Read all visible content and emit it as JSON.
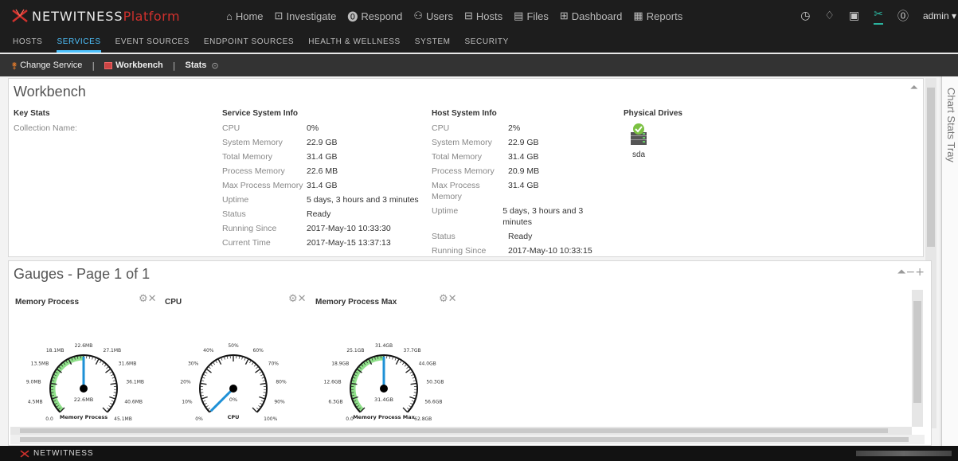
{
  "app": {
    "brand": "NETWITNESS",
    "product": "Platform",
    "user": "admin",
    "footer_brand": "NETWITNESS"
  },
  "mainnav": [
    {
      "icon": "home-icon",
      "glyph": "⌂",
      "label": "Home"
    },
    {
      "icon": "investigate-icon",
      "glyph": "⊡",
      "label": "Investigate"
    },
    {
      "icon": "respond-icon",
      "glyph": "⓿",
      "label": "Respond"
    },
    {
      "icon": "users-icon",
      "glyph": "⚇",
      "label": "Users"
    },
    {
      "icon": "hosts-icon",
      "glyph": "⊟",
      "label": "Hosts"
    },
    {
      "icon": "files-icon",
      "glyph": "▤",
      "label": "Files"
    },
    {
      "icon": "dashboard-icon",
      "glyph": "⊞",
      "label": "Dashboard"
    },
    {
      "icon": "reports-icon",
      "glyph": "▦",
      "label": "Reports"
    }
  ],
  "subnav": [
    "HOSTS",
    "SERVICES",
    "EVENT SOURCES",
    "ENDPOINT SOURCES",
    "HEALTH & WELLNESS",
    "SYSTEM",
    "SECURITY"
  ],
  "toolbar": {
    "change_service": "Change Service",
    "workbench": "Workbench",
    "stats": "Stats"
  },
  "workbench": {
    "title": "Workbench",
    "key_stats": {
      "header": "Key Stats",
      "rows": [
        {
          "k": "Collection Name:",
          "v": ""
        }
      ]
    },
    "service_system": {
      "header": "Service System Info",
      "rows": [
        {
          "k": "CPU",
          "v": "0%"
        },
        {
          "k": "System Memory",
          "v": "22.9 GB"
        },
        {
          "k": "Total Memory",
          "v": "31.4 GB"
        },
        {
          "k": "Process Memory",
          "v": "22.6 MB"
        },
        {
          "k": "Max Process Memory",
          "v": "31.4 GB"
        },
        {
          "k": "Uptime",
          "v": "5 days, 3 hours and 3 minutes"
        },
        {
          "k": "Status",
          "v": "Ready"
        },
        {
          "k": "Running Since",
          "v": "2017-May-10 10:33:30"
        },
        {
          "k": "Current Time",
          "v": "2017-May-15 13:37:13"
        }
      ]
    },
    "host_system": {
      "header": "Host System Info",
      "rows": [
        {
          "k": "CPU",
          "v": "2%"
        },
        {
          "k": "System Memory",
          "v": "22.9 GB"
        },
        {
          "k": "Total Memory",
          "v": "31.4 GB"
        },
        {
          "k": "Process Memory",
          "v": "20.9 MB"
        },
        {
          "k": "Max Process Memory",
          "v": "31.4 GB"
        },
        {
          "k": "Uptime",
          "v": "5 days, 3 hours and 3 minutes"
        },
        {
          "k": "Status",
          "v": "Ready"
        },
        {
          "k": "Running Since",
          "v": "2017-May-10 10:33:15"
        }
      ]
    },
    "physical_drives": {
      "header": "Physical Drives",
      "drive": "sda"
    }
  },
  "gauges": {
    "title": "Gauges - Page 1 of 1",
    "items": [
      {
        "name": "Memory Process",
        "center_label": "Memory Process",
        "value_label": "22.6MB",
        "ticks": [
          "0.0",
          "4.5MB",
          "9.0MB",
          "13.5MB",
          "18.1MB",
          "22.6MB",
          "27.1MB",
          "31.6MB",
          "36.1MB",
          "40.6MB",
          "45.1MB"
        ],
        "value_fraction": 0.5,
        "band_fraction": 0.5
      },
      {
        "name": "CPU",
        "center_label": "CPU",
        "value_label": "0%",
        "ticks": [
          "0%",
          "10%",
          "20%",
          "30%",
          "40%",
          "50%",
          "60%",
          "70%",
          "80%",
          "90%",
          "100%"
        ],
        "value_fraction": 0.0,
        "band_fraction": 0.0
      },
      {
        "name": "Memory Process Max",
        "center_label": "Memory Process Max",
        "value_label": "31.4GB",
        "ticks": [
          "0.0",
          "6.3GB",
          "12.6GB",
          "18.9GB",
          "25.1GB",
          "31.4GB",
          "37.7GB",
          "44.0GB",
          "50.3GB",
          "56.6GB",
          "62.8GB"
        ],
        "value_fraction": 0.5,
        "band_fraction": 0.5
      }
    ]
  },
  "tray": {
    "label": "Chart Stats Tray"
  },
  "colors": {
    "accent": "#4ec3ff",
    "gauge_band": "#8fe08a",
    "needle": "#1e90d6",
    "brand_red": "#d0312d"
  }
}
